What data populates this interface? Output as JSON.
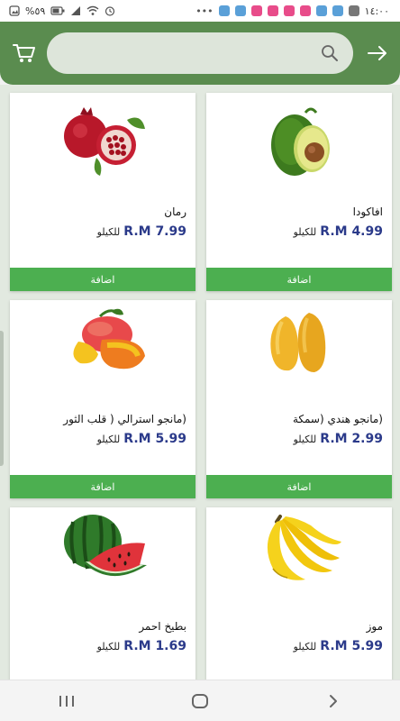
{
  "status_bar": {
    "time": "١٤:٠٠",
    "battery": "%٥٩"
  },
  "header": {
    "search": {
      "placeholder": "",
      "value": ""
    }
  },
  "products": [
    {
      "name": "افاكودا",
      "price": "R.M 4.99",
      "unit": "للكيلو",
      "add_label": "اضافة",
      "image": "avocado"
    },
    {
      "name": "رمان",
      "price": "R.M 7.99",
      "unit": "للكيلو",
      "add_label": "اضافة",
      "image": "pomegranate"
    },
    {
      "name": "(مانجو  هندي (سمكة",
      "price": "R.M 2.99",
      "unit": "للكيلو",
      "add_label": "اضافة",
      "image": "mango-indian"
    },
    {
      "name": "(مانجو استرالي ( قلب الثور",
      "price": "R.M 5.99",
      "unit": "للكيلو",
      "add_label": "اضافة",
      "image": "mango-australian"
    },
    {
      "name": "موز",
      "price": "R.M 5.99",
      "unit": "للكيلو",
      "add_label": "اضافة",
      "image": "banana"
    },
    {
      "name": "بطيخ احمر",
      "price": "R.M 1.69",
      "unit": "للكيلو",
      "add_label": "اضافة",
      "image": "watermelon"
    }
  ],
  "colors": {
    "header": "#5a8c4f",
    "add_button": "#4caf50",
    "price": "#2b3a8a"
  }
}
